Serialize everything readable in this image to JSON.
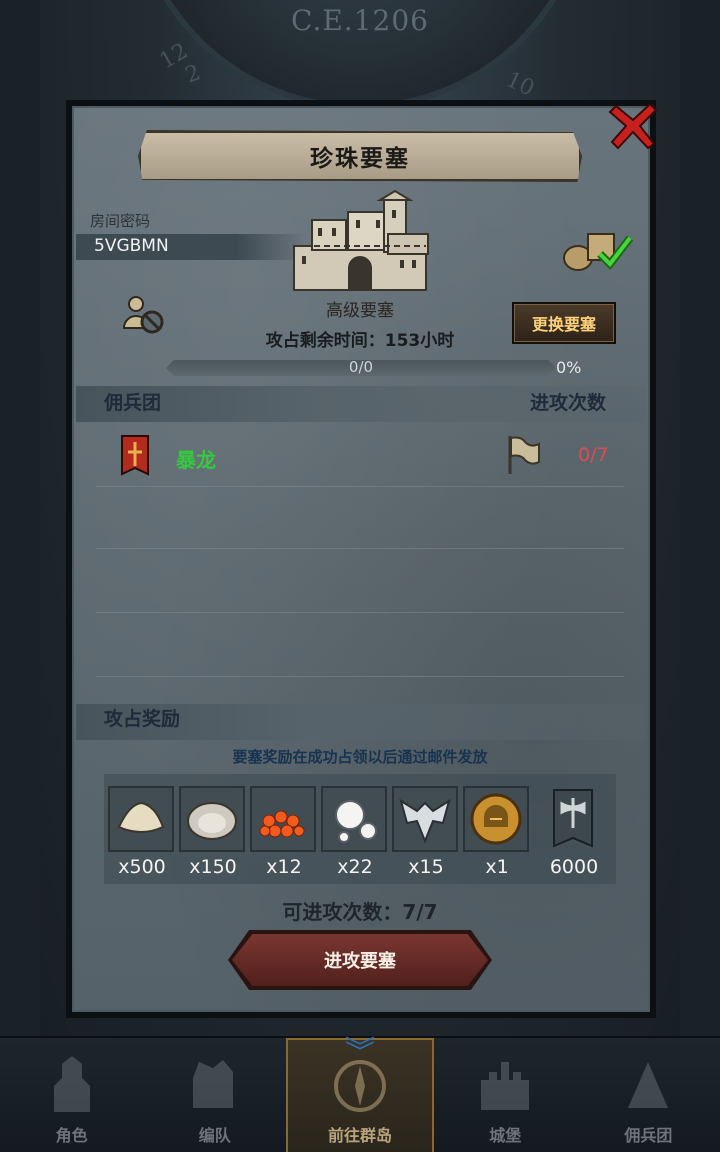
{
  "background": {
    "year": "C.E.1206",
    "clock_numbers": [
      "12",
      "2",
      "10"
    ]
  },
  "dialog": {
    "title": "珍珠要塞",
    "room": {
      "label": "房间密码",
      "code": "5VGBMN"
    },
    "fortress_grade": "高级要塞",
    "change_button": "更换要塞",
    "time_left": "攻占剩余时间：153小时",
    "progress": {
      "text": "0/0",
      "percent": "0%",
      "fill_fraction": 0
    },
    "mercenary_section": {
      "title": "佣兵团",
      "attacks_header": "进攻次数"
    },
    "teams": [
      {
        "name": "暴龙",
        "attacks": "0/7"
      }
    ],
    "reward_section": {
      "title": "攻占奖励",
      "note": "要塞奖励在成功占领以后通过邮件发放",
      "items": [
        {
          "icon": "cloth-icon",
          "qty": "x500"
        },
        {
          "icon": "oyster-icon",
          "qty": "x150"
        },
        {
          "icon": "roe-icon",
          "qty": "x12"
        },
        {
          "icon": "pearls-icon",
          "qty": "x22"
        },
        {
          "icon": "wing-emblem-icon",
          "qty": "x15"
        },
        {
          "icon": "helmet-coin-icon",
          "qty": "x1"
        },
        {
          "icon": "axe-banner-icon",
          "qty": "6000"
        }
      ]
    },
    "attempts": "可进攻次数：7/7",
    "attack_button": "进攻要塞"
  },
  "bottom_nav": [
    {
      "label": "角色",
      "icon": "knight-icon",
      "active": false
    },
    {
      "label": "编队",
      "icon": "formation-icon",
      "active": false
    },
    {
      "label": "前往群岛",
      "icon": "compass-icon",
      "active": true
    },
    {
      "label": "城堡",
      "icon": "castle-icon",
      "active": false
    },
    {
      "label": "佣兵团",
      "icon": "mercenary-icon",
      "active": false
    }
  ],
  "colors": {
    "team_name": "#35c93d",
    "attack_count": "#e04c4c",
    "change_button_text": "#ffd27a",
    "attack_button": "#7a3631"
  }
}
